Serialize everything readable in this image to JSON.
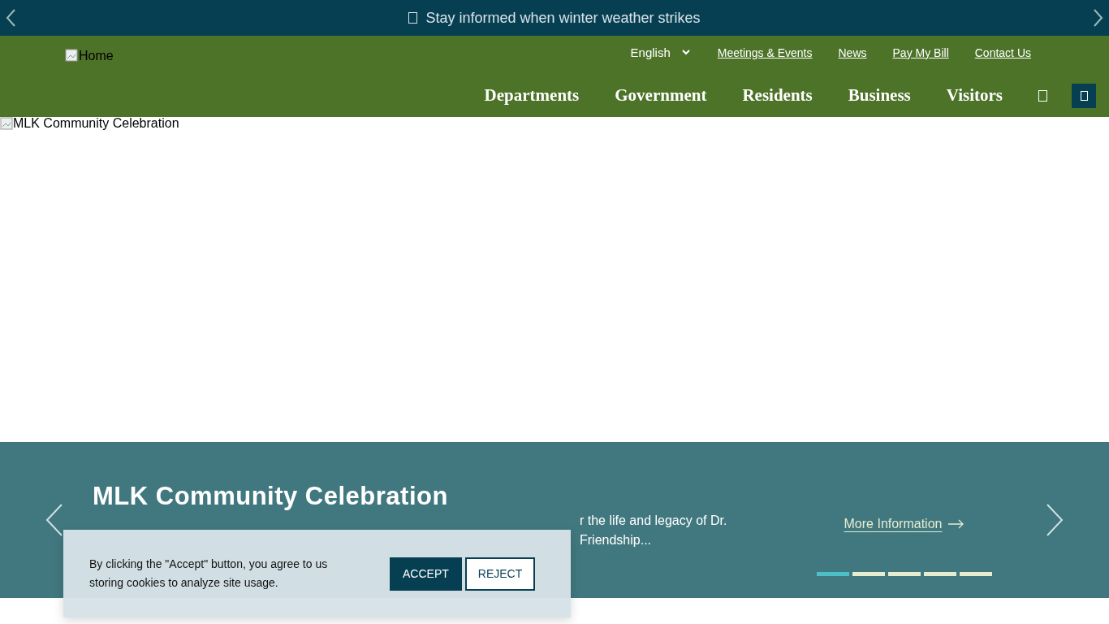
{
  "alert_bar": {
    "text": "Stay informed when winter weather strikes"
  },
  "header": {
    "logo_alt": "Home",
    "language": "English",
    "utility_links": [
      "Meetings & Events",
      "News",
      "Pay My Bill",
      "Contact Us"
    ],
    "nav": [
      "Departments",
      "Government",
      "Residents",
      "Business",
      "Visitors"
    ]
  },
  "hero": {
    "image_alt": "MLK Community Celebration"
  },
  "slide": {
    "title": "MLK Community Celebration",
    "description_lines": [
      "r the life and legacy of Dr.",
      "Friendship..."
    ],
    "link": "More Information",
    "dots": [
      {
        "selected": true
      },
      {
        "selected": false
      },
      {
        "selected": false
      },
      {
        "selected": false
      },
      {
        "selected": false
      }
    ]
  },
  "cookie_banner": {
    "text": "By clicking the \"Accept\" button, you agree to us storing cookies to analyze site usage.",
    "buttons": [
      "ACCEPT",
      "REJECT"
    ]
  }
}
